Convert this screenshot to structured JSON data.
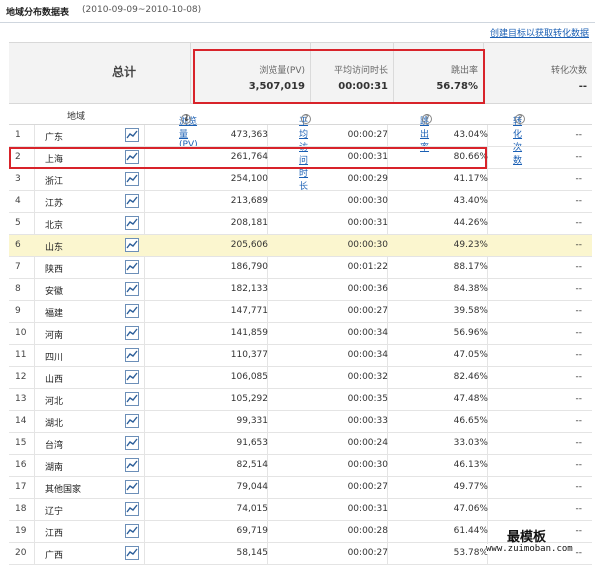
{
  "header": {
    "title": "地域分布数据表",
    "date_range": "(2010-09-09~2010-10-08)",
    "create_link": "创建目标以获取转化数据"
  },
  "summary": {
    "label": "总计",
    "pv_header": "浏览量(PV)",
    "pv_value": "3,507,019",
    "time_header": "平均访问时长",
    "time_value": "00:00:31",
    "bounce_header": "跳出率",
    "bounce_value": "56.78%",
    "conv_header": "转化次数",
    "conv_value": "--"
  },
  "columns": {
    "area": "地域",
    "pv": "浏览量(PV)",
    "time": "平均访问时长",
    "bounce": "跳出率",
    "conv": "转化次数",
    "sort_arrow": "↓",
    "help": "?"
  },
  "rows": [
    {
      "rank": "1",
      "name": "广东",
      "pv": "473,363",
      "time": "00:00:27",
      "bounce": "43.04%",
      "conv": "--"
    },
    {
      "rank": "2",
      "name": "上海",
      "pv": "261,764",
      "time": "00:00:31",
      "bounce": "80.66%",
      "conv": "--"
    },
    {
      "rank": "3",
      "name": "浙江",
      "pv": "254,100",
      "time": "00:00:29",
      "bounce": "41.17%",
      "conv": "--"
    },
    {
      "rank": "4",
      "name": "江苏",
      "pv": "213,689",
      "time": "00:00:30",
      "bounce": "43.40%",
      "conv": "--"
    },
    {
      "rank": "5",
      "name": "北京",
      "pv": "208,181",
      "time": "00:00:31",
      "bounce": "44.26%",
      "conv": "--"
    },
    {
      "rank": "6",
      "name": "山东",
      "pv": "205,606",
      "time": "00:00:30",
      "bounce": "49.23%",
      "conv": "--"
    },
    {
      "rank": "7",
      "name": "陕西",
      "pv": "186,790",
      "time": "00:01:22",
      "bounce": "88.17%",
      "conv": "--"
    },
    {
      "rank": "8",
      "name": "安徽",
      "pv": "182,133",
      "time": "00:00:36",
      "bounce": "84.38%",
      "conv": "--"
    },
    {
      "rank": "9",
      "name": "福建",
      "pv": "147,771",
      "time": "00:00:27",
      "bounce": "39.58%",
      "conv": "--"
    },
    {
      "rank": "10",
      "name": "河南",
      "pv": "141,859",
      "time": "00:00:34",
      "bounce": "56.96%",
      "conv": "--"
    },
    {
      "rank": "11",
      "name": "四川",
      "pv": "110,377",
      "time": "00:00:34",
      "bounce": "47.05%",
      "conv": "--"
    },
    {
      "rank": "12",
      "name": "山西",
      "pv": "106,085",
      "time": "00:00:32",
      "bounce": "82.46%",
      "conv": "--"
    },
    {
      "rank": "13",
      "name": "河北",
      "pv": "105,292",
      "time": "00:00:35",
      "bounce": "47.48%",
      "conv": "--"
    },
    {
      "rank": "14",
      "name": "湖北",
      "pv": "99,331",
      "time": "00:00:33",
      "bounce": "46.65%",
      "conv": "--"
    },
    {
      "rank": "15",
      "name": "台湾",
      "pv": "91,653",
      "time": "00:00:24",
      "bounce": "33.03%",
      "conv": "--"
    },
    {
      "rank": "16",
      "name": "湖南",
      "pv": "82,514",
      "time": "00:00:30",
      "bounce": "46.13%",
      "conv": "--"
    },
    {
      "rank": "17",
      "name": "其他国家",
      "pv": "79,044",
      "time": "00:00:27",
      "bounce": "49.77%",
      "conv": "--"
    },
    {
      "rank": "18",
      "name": "辽宁",
      "pv": "74,015",
      "time": "00:00:31",
      "bounce": "47.06%",
      "conv": "--"
    },
    {
      "rank": "19",
      "name": "江西",
      "pv": "69,719",
      "time": "00:00:28",
      "bounce": "61.44%",
      "conv": "--"
    },
    {
      "rank": "20",
      "name": "广西",
      "pv": "58,145",
      "time": "00:00:27",
      "bounce": "53.78%",
      "conv": "--"
    }
  ],
  "highlighted_row": "6",
  "boxed_row": "2",
  "colors": {
    "highlight": "#fbf6cf",
    "redbox": "#d8232a",
    "link": "#1a5fb4"
  },
  "icons": {
    "trend": "trend-chart-icon",
    "help": "help-circle-icon"
  },
  "watermark": {
    "line1": "最模板",
    "line2": "www.zuimoban.com"
  }
}
